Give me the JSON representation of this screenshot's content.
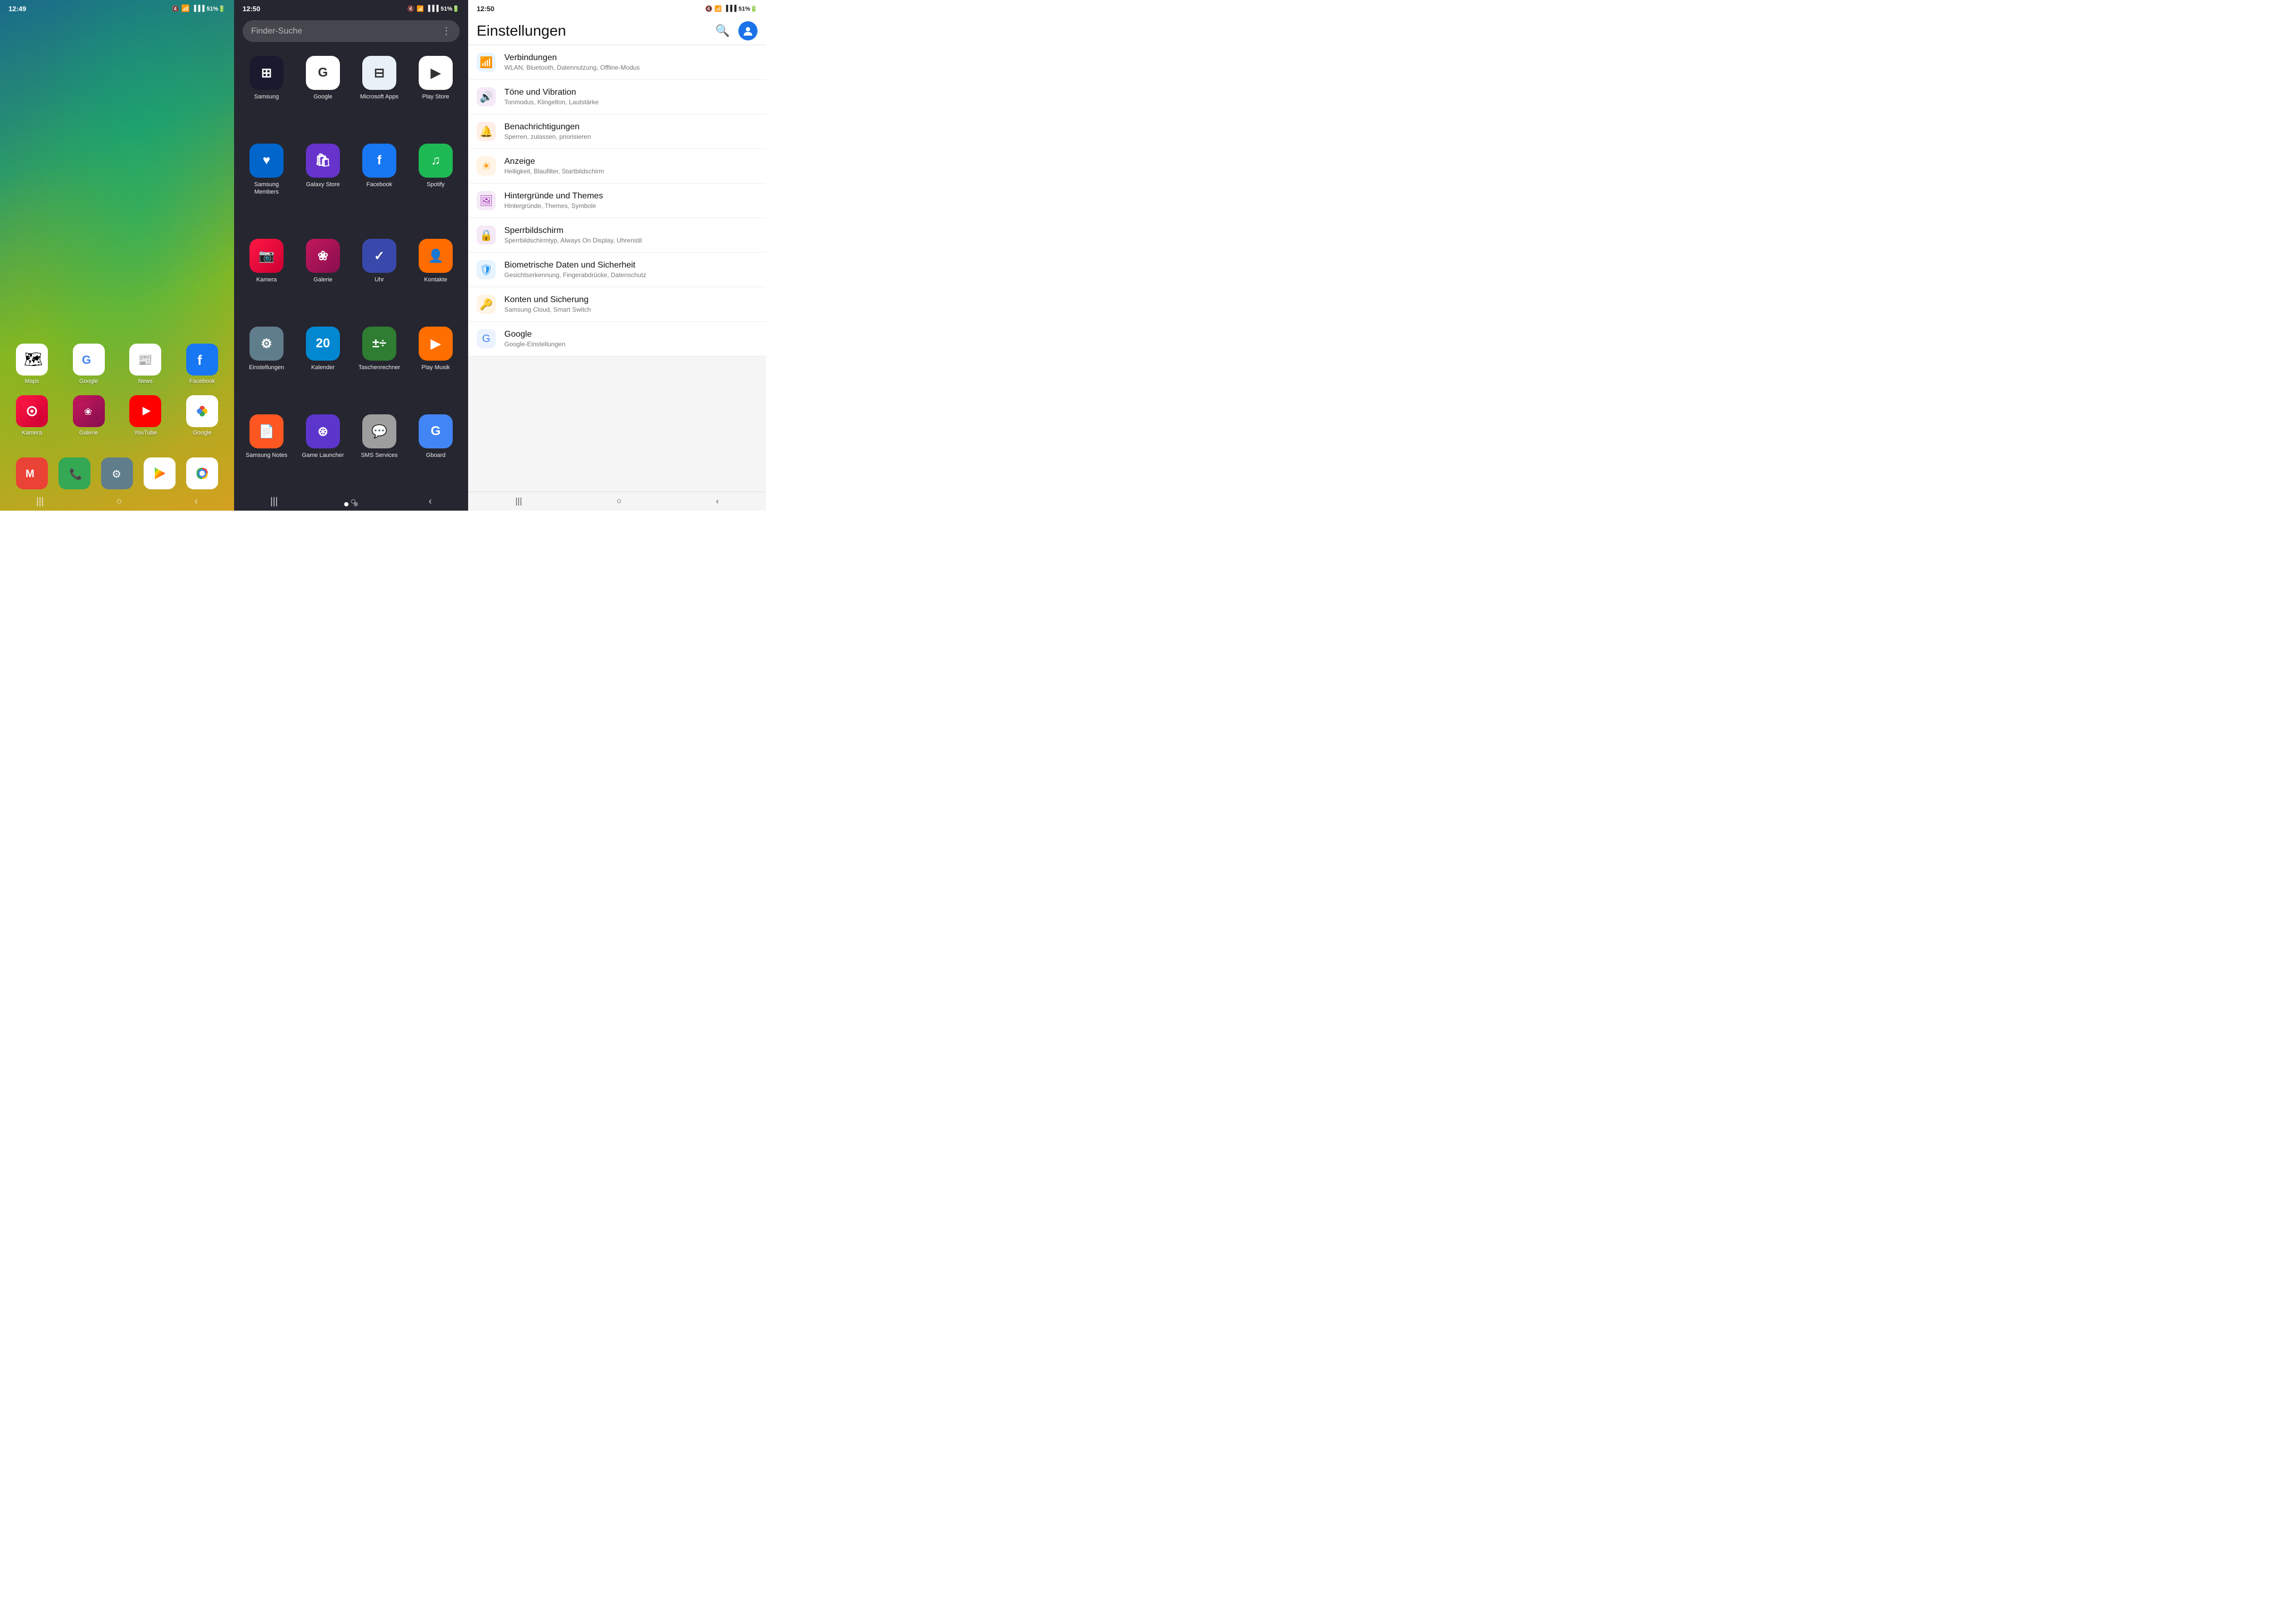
{
  "panel1": {
    "time": "12:49",
    "status": {
      "mute": "🔇",
      "wifi": "WiFi",
      "signal": "📶",
      "battery": "51%"
    },
    "rows": [
      [
        {
          "label": "Maps",
          "bg": "ic-maps",
          "emoji": "🗺️"
        },
        {
          "label": "Google",
          "bg": "ic-google-g",
          "emoji": "G"
        },
        {
          "label": "News",
          "bg": "ic-news",
          "emoji": "📰"
        },
        {
          "label": "Facebook",
          "bg": "ic-facebook-home",
          "emoji": "f"
        }
      ],
      [
        {
          "label": "Kamera",
          "bg": "ic-camera",
          "emoji": "📷"
        },
        {
          "label": "Galerie",
          "bg": "ic-galerie",
          "emoji": "❀"
        },
        {
          "label": "YouTube",
          "bg": "ic-youtube",
          "emoji": "▶"
        },
        {
          "label": "Google",
          "bg": "ic-google-photos",
          "emoji": "⊛"
        }
      ]
    ],
    "dock": [
      {
        "label": "Mail",
        "bg": "ic-mail",
        "emoji": "M"
      },
      {
        "label": "Phone",
        "bg": "ic-phone",
        "emoji": "📞"
      },
      {
        "label": "Settings",
        "bg": "ic-settings-dock",
        "emoji": "⚙"
      },
      {
        "label": "Play Store",
        "bg": "ic-playstore",
        "emoji": "▶"
      },
      {
        "label": "Chrome",
        "bg": "ic-chrome",
        "emoji": "◉"
      }
    ]
  },
  "panel2": {
    "time": "12:50",
    "search_placeholder": "Finder-Suche",
    "apps": [
      {
        "label": "Samsung",
        "bg": "ic-samsung-apps",
        "emoji": "⊞"
      },
      {
        "label": "Google",
        "bg": "ic-google-apps",
        "emoji": "G"
      },
      {
        "label": "Microsoft Apps",
        "bg": "ic-microsoft",
        "emoji": "⊟"
      },
      {
        "label": "Play Store",
        "bg": "ic-playstore-d",
        "emoji": "▶"
      },
      {
        "label": "Samsung Members",
        "bg": "ic-samsung-members",
        "emoji": "♥"
      },
      {
        "label": "Galaxy Store",
        "bg": "ic-galaxy-store",
        "emoji": "🛍"
      },
      {
        "label": "Facebook",
        "bg": "ic-facebook-d",
        "emoji": "f"
      },
      {
        "label": "Spotify",
        "bg": "ic-spotify",
        "emoji": "♫"
      },
      {
        "label": "Kamera",
        "bg": "ic-camera-d",
        "emoji": "📷"
      },
      {
        "label": "Galerie",
        "bg": "ic-galerie-d",
        "emoji": "❀"
      },
      {
        "label": "Uhr",
        "bg": "ic-clock",
        "emoji": "✓"
      },
      {
        "label": "Kontakte",
        "bg": "ic-contacts",
        "emoji": "👤"
      },
      {
        "label": "Einstellungen",
        "bg": "ic-settings-d",
        "emoji": "⚙"
      },
      {
        "label": "Kalender",
        "bg": "ic-calendar",
        "emoji": "20"
      },
      {
        "label": "Taschenrechner",
        "bg": "ic-calculator",
        "emoji": "±÷"
      },
      {
        "label": "Play Musik",
        "bg": "ic-play-music",
        "emoji": "▶"
      },
      {
        "label": "Samsung Notes",
        "bg": "ic-samsung-notes",
        "emoji": "📄"
      },
      {
        "label": "Game Launcher",
        "bg": "ic-game-launcher",
        "emoji": "⊛"
      },
      {
        "label": "SMS Services",
        "bg": "ic-sms",
        "emoji": "💬"
      },
      {
        "label": "Gboard",
        "bg": "ic-gboard",
        "emoji": "G"
      }
    ]
  },
  "panel3": {
    "time": "12:50",
    "title": "Einstellungen",
    "settings": [
      {
        "icon": "📶",
        "icon_class": "si-wifi",
        "title": "Verbindungen",
        "subtitle": "WLAN, Bluetooth, Datennutzung, Offline-Modus"
      },
      {
        "icon": "🔊",
        "icon_class": "si-sound",
        "title": "Töne und Vibration",
        "subtitle": "Tonmodus, Klingelton, Lautstärke"
      },
      {
        "icon": "🔔",
        "icon_class": "si-notif",
        "title": "Benachrichtigungen",
        "subtitle": "Sperren, zulassen, priorisieren"
      },
      {
        "icon": "☀",
        "icon_class": "si-display",
        "title": "Anzeige",
        "subtitle": "Helligkeit, Blaufilter, Startbildschirm"
      },
      {
        "icon": "🖼",
        "icon_class": "si-wallpaper",
        "title": "Hintergründe und Themes",
        "subtitle": "Hintergründe, Themes, Symbole"
      },
      {
        "icon": "🔒",
        "icon_class": "si-lock",
        "title": "Sperrbildschirm",
        "subtitle": "Sperrbildschirmtyp, Always On Display, Uhrenstil"
      },
      {
        "icon": "🛡",
        "icon_class": "si-biometric",
        "title": "Biometrische Daten und Sicherheit",
        "subtitle": "Gesichtserkennung, Fingerabdrücke, Datenschutz"
      },
      {
        "icon": "🔑",
        "icon_class": "si-accounts",
        "title": "Konten und Sicherung",
        "subtitle": "Samsung Cloud, Smart Switch"
      },
      {
        "icon": "G",
        "icon_class": "si-google",
        "title": "Google",
        "subtitle": "Google-Einstellungen"
      }
    ]
  }
}
